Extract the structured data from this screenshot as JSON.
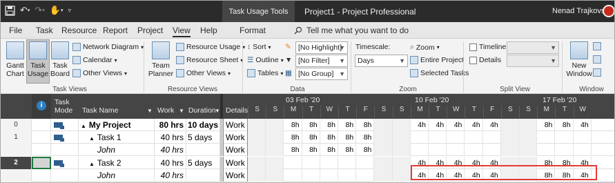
{
  "titlebar": {
    "context_tab": "Task Usage Tools",
    "app_title": "Project1  -  Project Professional",
    "user": "Nenad Trajkovski"
  },
  "menu": {
    "tabs": [
      "File",
      "Task",
      "Resource",
      "Report",
      "Project",
      "View",
      "Help",
      "Format"
    ],
    "active_tab": "View",
    "tell_me": "Tell me what you want to do"
  },
  "ribbon": {
    "task_views": {
      "label": "Task Views",
      "gantt_chart": "Gantt\nChart",
      "task_usage": "Task\nUsage",
      "task_board": "Task\nBoard",
      "network_diagram": "Network Diagram",
      "calendar": "Calendar",
      "other_views": "Other Views"
    },
    "resource_views": {
      "label": "Resource Views",
      "team_planner": "Team\nPlanner",
      "resource_usage": "Resource Usage",
      "resource_sheet": "Resource Sheet",
      "other_views": "Other Views"
    },
    "data": {
      "label": "Data",
      "sort": "Sort",
      "outline": "Outline",
      "tables": "Tables",
      "highlight": "[No Highlight]",
      "filter": "[No Filter]",
      "group": "[No Group]"
    },
    "zoom": {
      "label": "Zoom",
      "timescale": "Timescale:",
      "timescale_value": "Days",
      "zoom": "Zoom",
      "entire_project": "Entire Project",
      "selected_tasks": "Selected Tasks"
    },
    "split_view": {
      "label": "Split View",
      "timeline": "Timeline",
      "details": "Details"
    },
    "window": {
      "label": "Window",
      "new_window": "New\nWindow"
    }
  },
  "grid": {
    "headers": {
      "task_mode": "Task\nMode",
      "task_name": "Task Name",
      "work": "Work",
      "duration": "Duration",
      "details": "Details"
    },
    "weeks": [
      "03 Feb '20",
      "10 Feb '20",
      "17 Feb '20"
    ],
    "days": [
      "S",
      "S",
      "M",
      "T",
      "W",
      "T",
      "F",
      "S",
      "S",
      "M",
      "T",
      "W",
      "T",
      "F",
      "S",
      "S",
      "M",
      "T",
      "W"
    ],
    "rows": [
      {
        "id": "0",
        "name": "My Project",
        "work": "80 hrs",
        "duration": "10 days",
        "detail": "Work",
        "bold": true,
        "italic": false,
        "indent": 0,
        "outline": "▲",
        "mode": true,
        "values": [
          "",
          "",
          "8h",
          "8h",
          "8h",
          "8h",
          "8h",
          "",
          "",
          "4h",
          "4h",
          "4h",
          "4h",
          "4h",
          "",
          "",
          "8h",
          "8h",
          "4h"
        ]
      },
      {
        "id": "1",
        "name": "Task 1",
        "work": "40 hrs",
        "duration": "5 days",
        "detail": "Work",
        "bold": false,
        "italic": false,
        "indent": 1,
        "outline": "▲",
        "mode": true,
        "values": [
          "",
          "",
          "8h",
          "8h",
          "8h",
          "8h",
          "8h",
          "",
          "",
          "",
          "",
          "",
          "",
          "",
          "",
          "",
          "",
          "",
          ""
        ]
      },
      {
        "id": "",
        "name": "John",
        "work": "40 hrs",
        "duration": "",
        "detail": "Work",
        "bold": false,
        "italic": true,
        "indent": 2,
        "outline": "",
        "mode": false,
        "values": [
          "",
          "",
          "8h",
          "8h",
          "8h",
          "8h",
          "8h",
          "",
          "",
          "",
          "",
          "",
          "",
          "",
          "",
          "",
          "",
          "",
          ""
        ]
      },
      {
        "id": "2",
        "name": "Task 2",
        "work": "40 hrs",
        "duration": "5 days",
        "detail": "Work",
        "bold": false,
        "italic": false,
        "indent": 1,
        "outline": "▲",
        "mode": true,
        "values": [
          "",
          "",
          "",
          "",
          "",
          "",
          "",
          "",
          "",
          "4h",
          "4h",
          "4h",
          "4h",
          "4h",
          "",
          "",
          "8h",
          "8h",
          "4h"
        ]
      },
      {
        "id": "",
        "name": "John",
        "work": "40 hrs",
        "duration": "",
        "detail": "Work",
        "bold": false,
        "italic": true,
        "indent": 2,
        "outline": "",
        "mode": false,
        "values": [
          "",
          "",
          "",
          "",
          "",
          "",
          "",
          "",
          "",
          "4h",
          "4h",
          "4h",
          "4h",
          "4h",
          "",
          "",
          "8h",
          "8h",
          "4h"
        ]
      }
    ],
    "selected_row": "2"
  },
  "colors": {
    "titlebar": "#2b2b2b",
    "header": "#454545",
    "highlight_border": "#e53935"
  }
}
